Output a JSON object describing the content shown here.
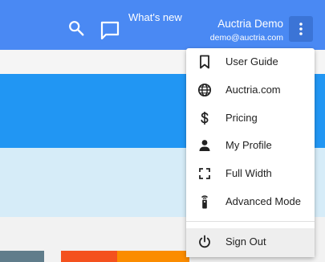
{
  "header": {
    "whats_new": "What's new",
    "user_name": "Auctria Demo",
    "user_email": "demo@auctria.com",
    "icons": [
      "search-icon",
      "feedback-icon",
      "more-vert-icon"
    ],
    "background": "#4a89f3"
  },
  "menu": {
    "items": [
      {
        "label": "User Guide",
        "icon": "bookmark-icon"
      },
      {
        "label": "Auctria.com",
        "icon": "globe-icon"
      },
      {
        "label": "Pricing",
        "icon": "dollar-icon"
      },
      {
        "label": "My Profile",
        "icon": "person-icon"
      },
      {
        "label": "Full Width",
        "icon": "fullscreen-icon"
      },
      {
        "label": "Advanced Mode",
        "icon": "remote-icon"
      }
    ],
    "signout": {
      "label": "Sign Out",
      "icon": "power-icon"
    }
  },
  "colors": {
    "brand_blue": "#4a89f3",
    "content_blue": "#2196f3",
    "content_pale": "#d6ecf8",
    "tile_grey": "#607d8b",
    "tile_red": "#f4511e",
    "tile_orange": "#fb8c00"
  }
}
